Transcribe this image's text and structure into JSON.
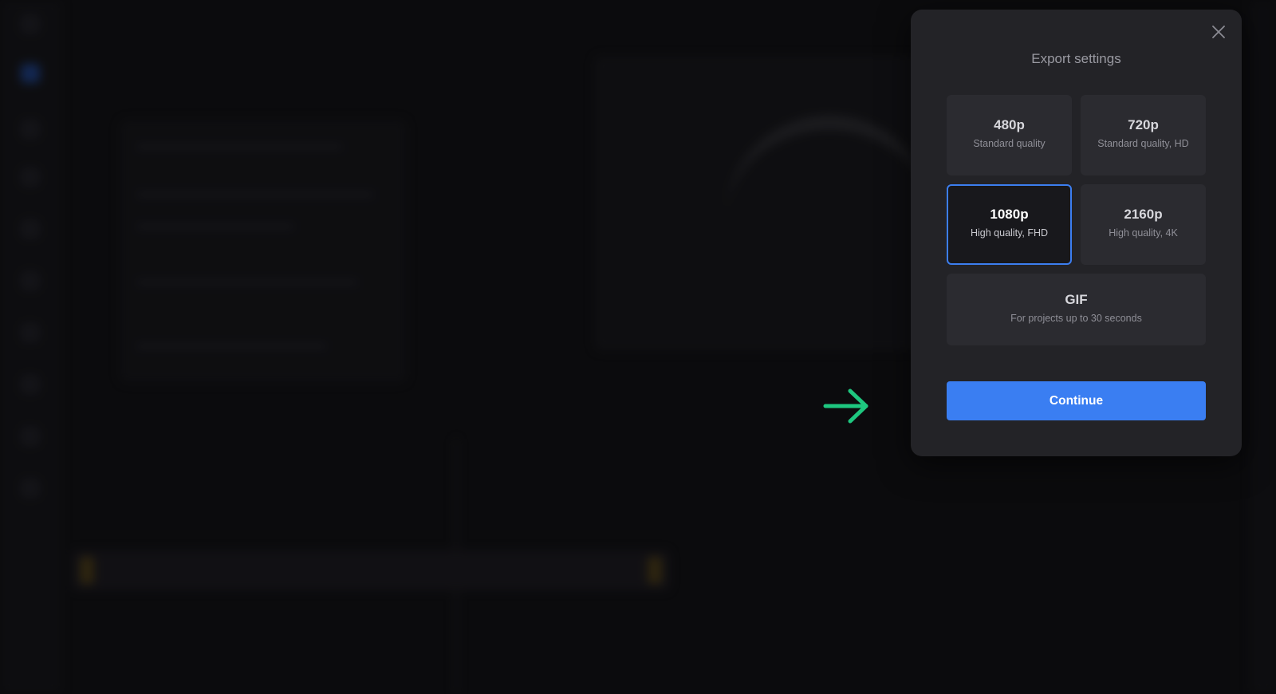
{
  "modal": {
    "title": "Export settings",
    "close_icon": "close-icon",
    "options": [
      {
        "id": "480p",
        "title": "480p",
        "subtitle": "Standard quality",
        "selected": false
      },
      {
        "id": "720p",
        "title": "720p",
        "subtitle": "Standard quality, HD",
        "selected": false
      },
      {
        "id": "1080p",
        "title": "1080p",
        "subtitle": "High quality, FHD",
        "selected": true
      },
      {
        "id": "2160p",
        "title": "2160p",
        "subtitle": "High quality, 4K",
        "selected": false
      },
      {
        "id": "gif",
        "title": "GIF",
        "subtitle": "For projects up to 30 seconds",
        "selected": false
      }
    ],
    "continue_label": "Continue"
  },
  "annotation": {
    "arrow_icon": "arrow-right-icon",
    "arrow_color": "#1ec77f"
  },
  "colors": {
    "accent": "#3a7ef2",
    "modal_bg": "#232327",
    "option_bg": "#2b2b30"
  }
}
